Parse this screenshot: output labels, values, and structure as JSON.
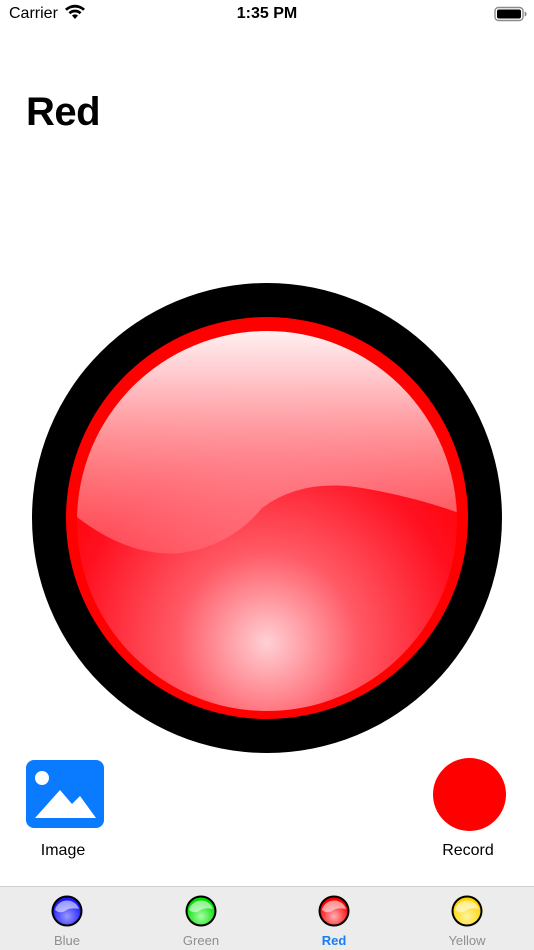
{
  "status_bar": {
    "carrier": "Carrier",
    "time": "1:35 PM"
  },
  "title": "Red",
  "main_button": {
    "icon": "red-orb-icon",
    "color": "#ff0000"
  },
  "controls": {
    "image_label": "Image",
    "image_icon": "photo-icon",
    "image_color": "#0a7aff",
    "record_label": "Record",
    "record_color": "#ff0000"
  },
  "tabs": [
    {
      "label": "Blue",
      "icon": "blue-orb-icon",
      "color": "#1a1aff",
      "active": false
    },
    {
      "label": "Green",
      "icon": "green-orb-icon",
      "color": "#00dd00",
      "active": false
    },
    {
      "label": "Red",
      "icon": "red-orb-icon",
      "color": "#ff0000",
      "active": true
    },
    {
      "label": "Yellow",
      "icon": "yellow-orb-icon",
      "color": "#ffdd00",
      "active": false
    }
  ],
  "active_tab_color": "#1a7cf0"
}
